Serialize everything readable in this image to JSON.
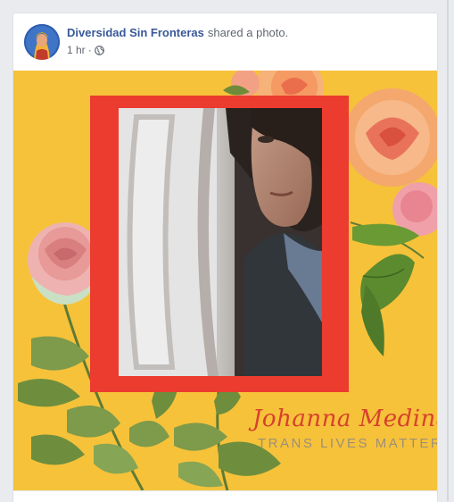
{
  "post": {
    "author": "Diversidad Sin Fronteras",
    "action": "shared a photo.",
    "timestamp": "1 hr",
    "separator": "·",
    "privacy_icon": "globe-icon"
  },
  "photo": {
    "name_signature": "Johanna Medina",
    "tagline": "TRANS LIVES MATTER",
    "colors": {
      "background": "#f6c23a",
      "frame": "#ec3b2f",
      "signature": "#d7412d",
      "tagline": "#9c8f7b"
    }
  },
  "theme": {
    "link_blue": "#385898",
    "meta_gray": "#616770",
    "page_bg": "#e9ebee"
  }
}
